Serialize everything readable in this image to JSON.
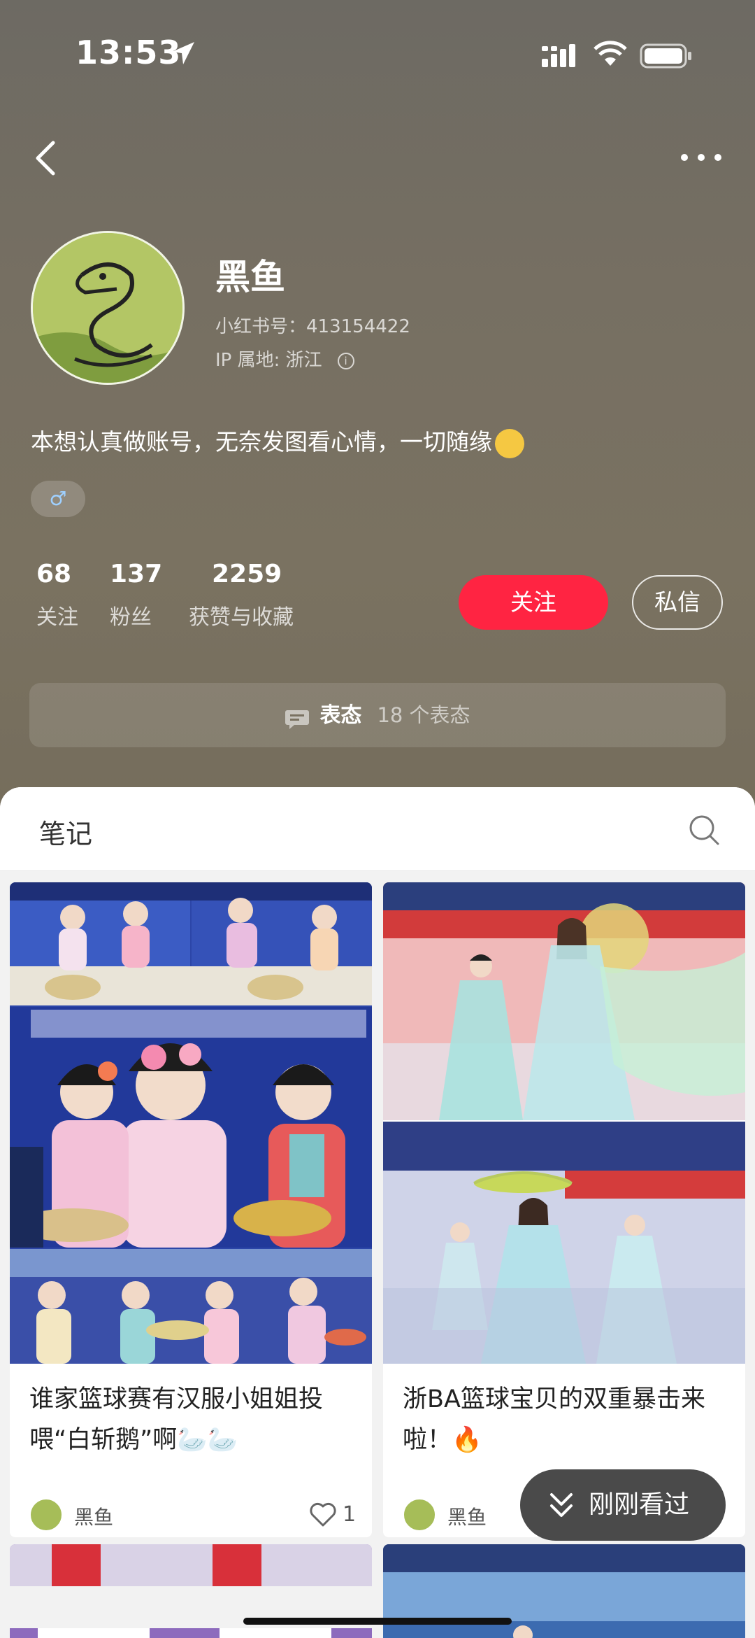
{
  "status_bar": {
    "time": "13:53"
  },
  "profile": {
    "name": "黑鱼",
    "id_label": "小红书号：413154422",
    "ip_label": "IP 属地: 浙江",
    "bio": "本想认真做账号，无奈发图看心情，一切随缘",
    "gender_symbol": "♂"
  },
  "stats": [
    {
      "num": "68",
      "label": "关注"
    },
    {
      "num": "137",
      "label": "粉丝"
    },
    {
      "num": "2259",
      "label": "获赞与收藏"
    }
  ],
  "actions": {
    "follow": "关注",
    "message": "私信"
  },
  "reactions": {
    "title": "表态",
    "count_text": "18 个表态"
  },
  "tabs": {
    "notes": "笔记"
  },
  "notes": [
    {
      "title": "谁家篮球赛有汉服小姐姐投喂“白斩鹅”啊🦢🦢",
      "author": "黑鱼",
      "likes": "1"
    },
    {
      "title": "浙BA篮球宝贝的双重暴击来啦！🔥",
      "author": "黑鱼"
    }
  ],
  "floating": {
    "recent": "刚刚看过"
  },
  "colors": {
    "accent": "#ff2442",
    "header_bg": "#756d5c"
  }
}
